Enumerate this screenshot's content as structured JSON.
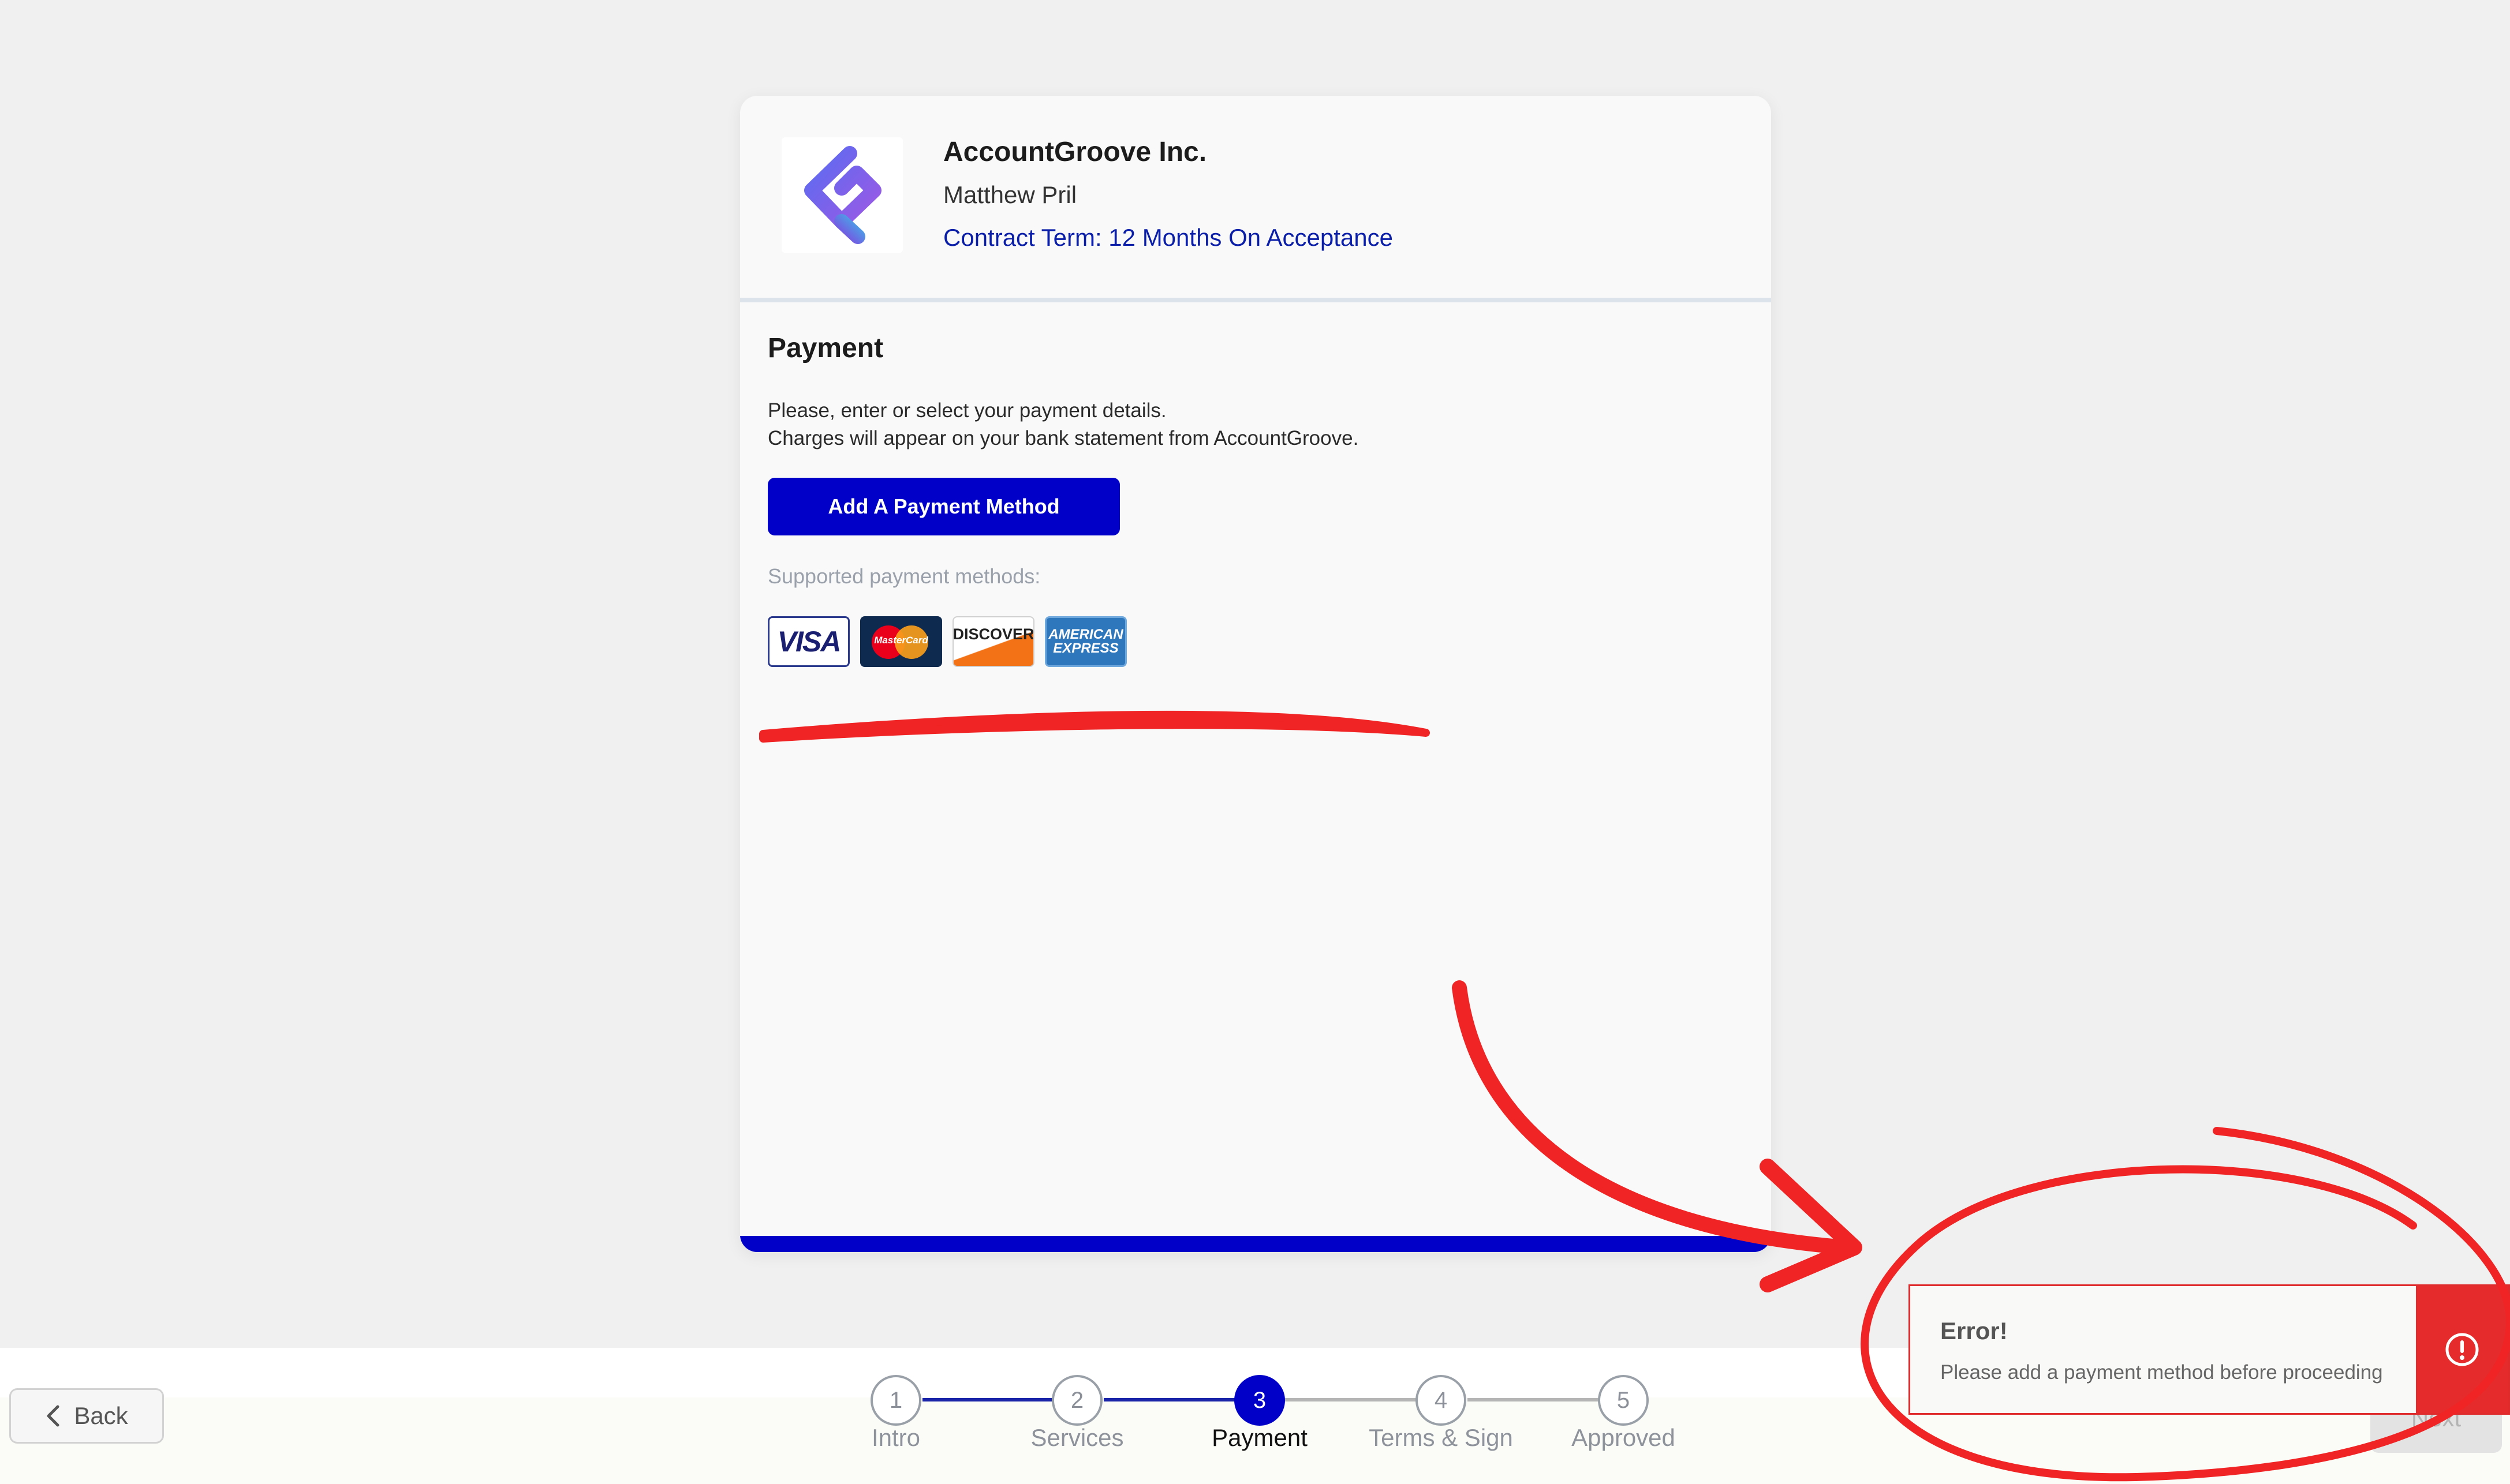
{
  "header": {
    "company": "AccountGroove Inc.",
    "contact": "Matthew Pril",
    "contract_term": "Contract Term: 12 Months On Acceptance"
  },
  "payment": {
    "title": "Payment",
    "desc_line1": "Please, enter or select your payment details.",
    "desc_line2": "Charges will appear on your bank statement from AccountGroove.",
    "add_button": "Add A Payment Method",
    "supported_label": "Supported payment methods:",
    "methods": {
      "visa": "VISA",
      "mastercard": "MasterCard",
      "discover": "DISCOVER",
      "amex_line1": "AMERICAN",
      "amex_line2": "EXPRESS"
    }
  },
  "footer": {
    "back_label": "Back",
    "next_label": "Next"
  },
  "steps": [
    {
      "number": "1",
      "label": "Intro"
    },
    {
      "number": "2",
      "label": "Services"
    },
    {
      "number": "3",
      "label": "Payment"
    },
    {
      "number": "4",
      "label": "Terms & Sign"
    },
    {
      "number": "5",
      "label": "Approved"
    }
  ],
  "active_step": 3,
  "toast": {
    "title": "Error!",
    "message": "Please add a payment method before proceeding"
  },
  "colors": {
    "brand_blue": "#0000c8",
    "error_red": "#e52b2b",
    "annotation_red": "#f02424"
  },
  "icons": {
    "logo": "accountgroove-logo-icon",
    "back": "chevron-left-icon",
    "toast": "exclamation-circle-icon"
  }
}
